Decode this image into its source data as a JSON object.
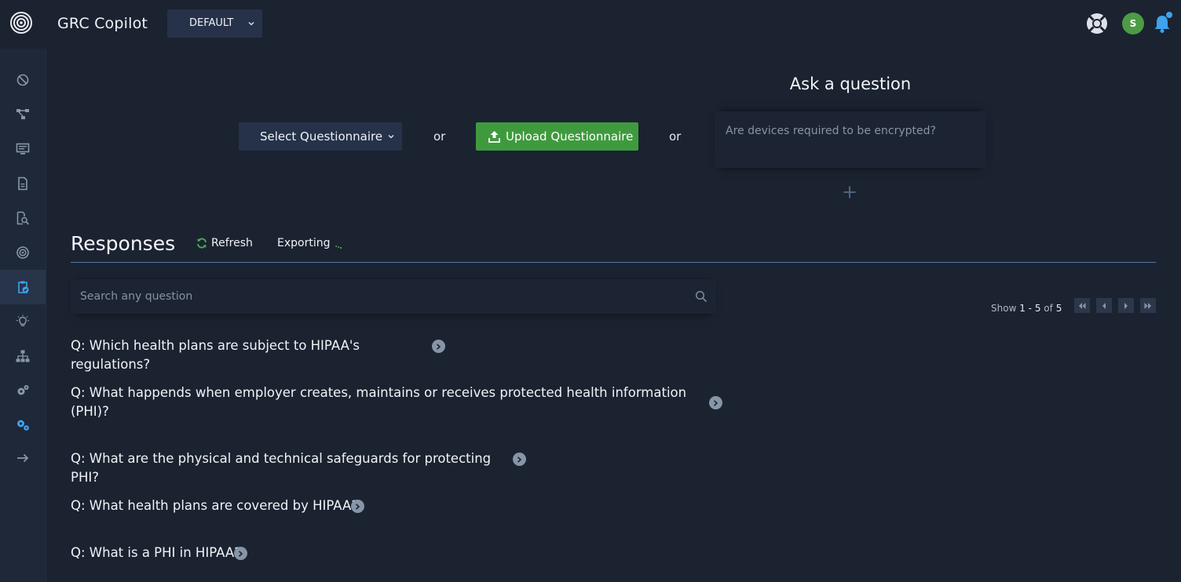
{
  "header": {
    "app_title": "GRC Copilot",
    "env_selector": {
      "value": "DEFAULT",
      "icon": "chevron-down-icon"
    },
    "avatar_initial": "S",
    "icons": [
      "logo-icon",
      "help-lifebuoy-icon",
      "bell-icon"
    ]
  },
  "sidebar": {
    "items": [
      {
        "name": "dashboard",
        "icon": "dashboard-icon"
      },
      {
        "name": "workflow",
        "icon": "workflow-icon"
      },
      {
        "name": "monitor",
        "icon": "monitor-icon"
      },
      {
        "name": "documents",
        "icon": "document-icon"
      },
      {
        "name": "document-search",
        "icon": "document-search-icon"
      },
      {
        "name": "radar",
        "icon": "radar-icon"
      },
      {
        "name": "questionnaire",
        "icon": "clipboard-check-icon",
        "active": true
      },
      {
        "name": "ideas",
        "icon": "lightbulb-icon"
      },
      {
        "name": "hierarchy",
        "icon": "hierarchy-icon"
      },
      {
        "name": "integrations",
        "icon": "gears-icon"
      },
      {
        "name": "settings",
        "icon": "settings-gears-icon"
      },
      {
        "name": "collapse",
        "icon": "arrow-right-icon"
      }
    ]
  },
  "questionnaire_bar": {
    "select_label": "Select Questionnaire",
    "or_label": "or",
    "upload_label": "Upload Questionnaire"
  },
  "ask": {
    "title": "Ask a question",
    "placeholder": "Are devices required to be encrypted?"
  },
  "responses": {
    "title": "Responses",
    "refresh_label": "Refresh",
    "exporting_label": "Exporting",
    "search_placeholder": "Search any question",
    "pager": {
      "prefix": "Show",
      "range": "1 - 5",
      "of_label": "of",
      "total": "5"
    },
    "questions": [
      "Q: Which health plans are subject to HIPAA's regulations?",
      "Q: What happends when employer creates, maintains or receives protected health information (PHI)?",
      "Q: What are the physical and technical safeguards for protecting PHI?",
      "Q: What health plans are covered by HIPAA?",
      "Q: What is a PHI in HIPAA?"
    ]
  },
  "colors": {
    "background": "#1b2331",
    "sidebar": "#1e2838",
    "primary_green": "#3f9a3e",
    "accent_blue": "#3ea3ec",
    "divider": "#54779c"
  }
}
